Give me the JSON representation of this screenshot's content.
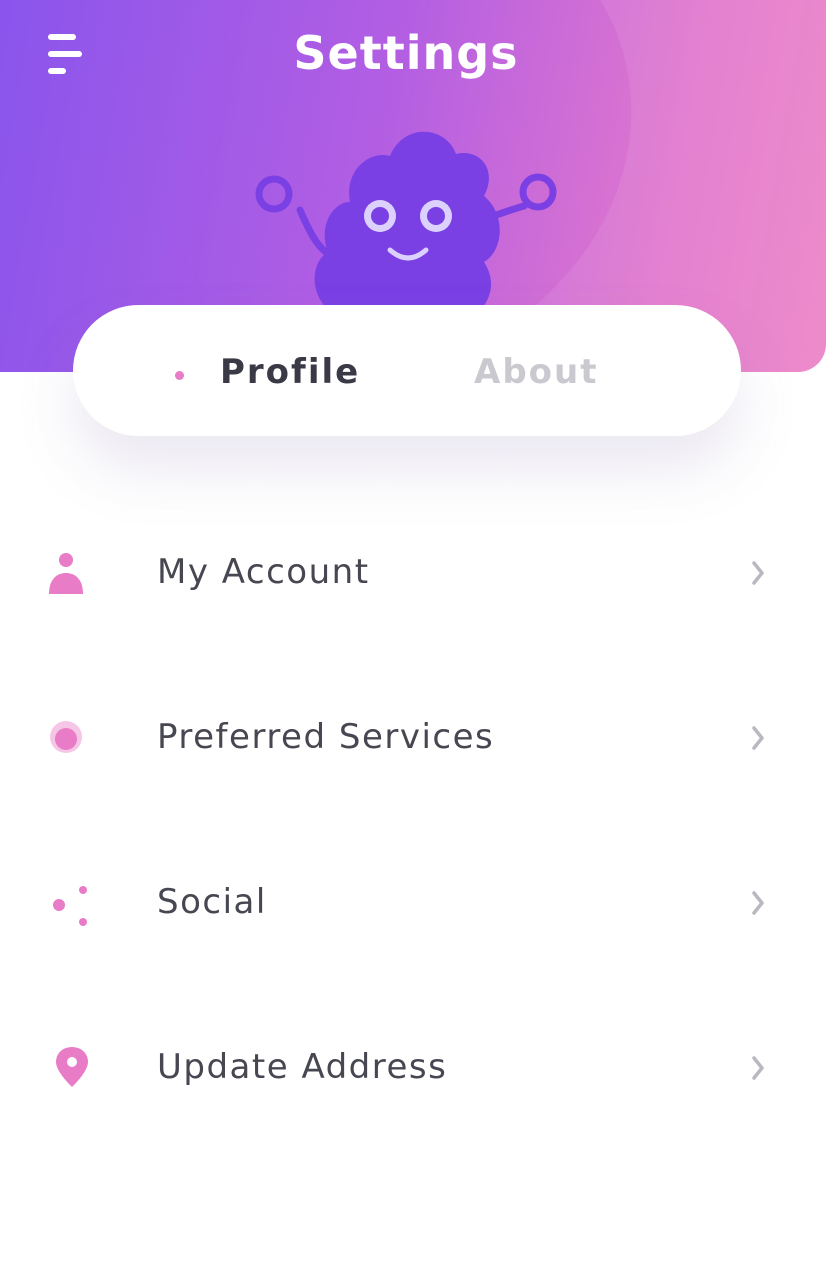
{
  "header": {
    "title": "Settings",
    "menu_icon": "menu-icon",
    "gradient_colors": [
      "#8a55ec",
      "#b25ee3",
      "#e277cd",
      "#ec81c6"
    ]
  },
  "mascot": {
    "icon": "mascot-illustration",
    "color": "#7a40e4"
  },
  "tabs": [
    {
      "label": "Profile",
      "active": true
    },
    {
      "label": "About",
      "active": false
    }
  ],
  "menu_items": [
    {
      "label": "My Account",
      "icon": "user-icon"
    },
    {
      "label": "Preferred Services",
      "icon": "services-icon"
    },
    {
      "label": "Social",
      "icon": "social-icon"
    },
    {
      "label": "Update Address",
      "icon": "location-pin-icon"
    }
  ],
  "colors": {
    "accent": "#e87cc6",
    "text_primary": "#474752",
    "text_muted": "#c9c9cf",
    "chevron": "#b8b8c0"
  }
}
